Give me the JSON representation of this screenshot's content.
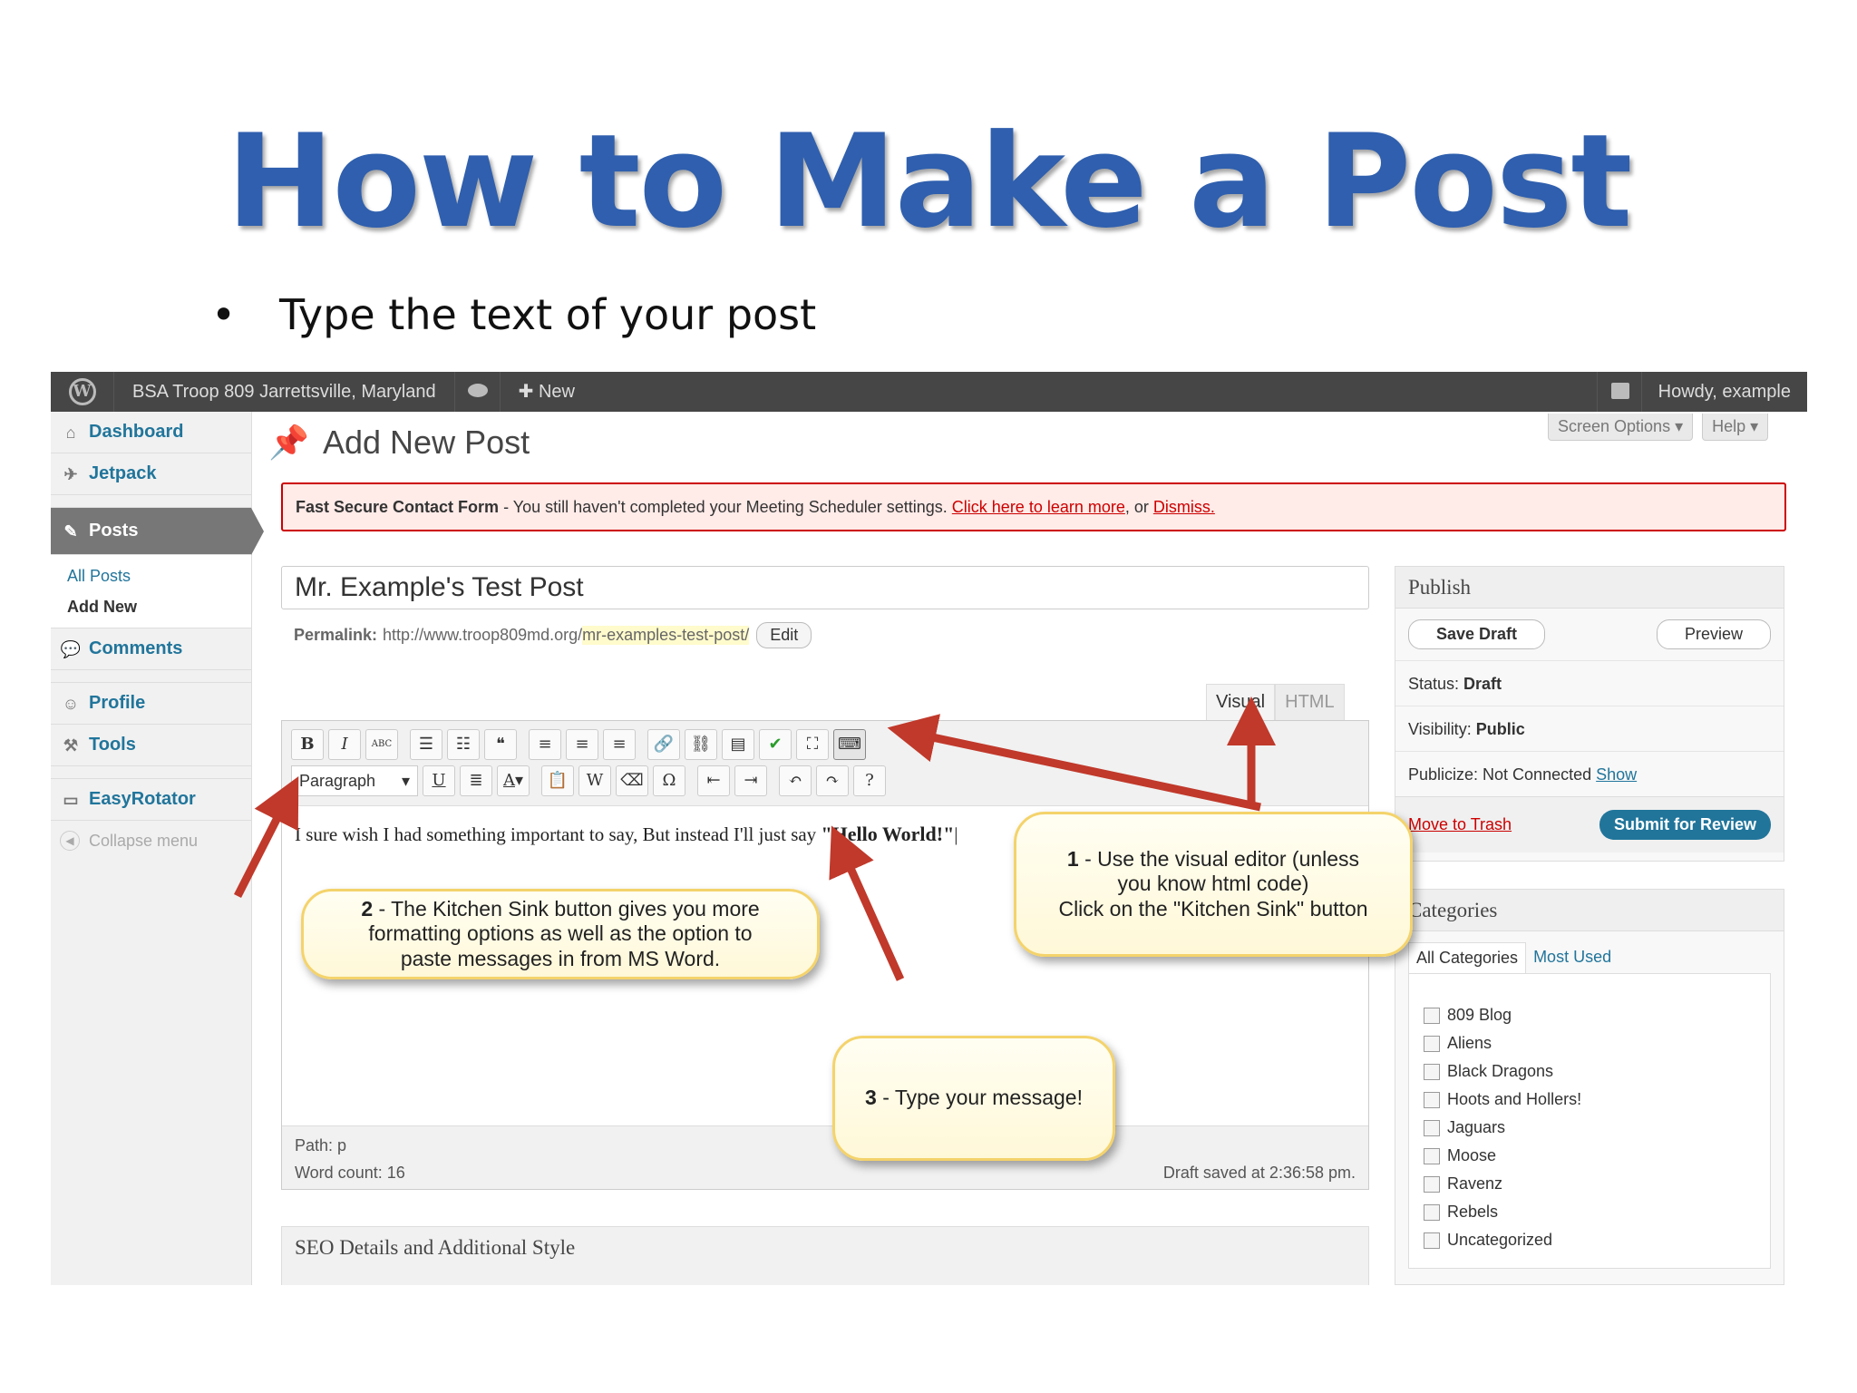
{
  "slide": {
    "title": "How to Make a Post",
    "bullet": "Type the text of your post"
  },
  "adminbar": {
    "site_name": "BSA Troop 809 Jarrettsville, Maryland",
    "new_label": "New",
    "howdy": "Howdy, example"
  },
  "sidebar": {
    "dashboard": "Dashboard",
    "jetpack": "Jetpack",
    "posts": "Posts",
    "all_posts": "All Posts",
    "add_new": "Add New",
    "comments": "Comments",
    "profile": "Profile",
    "tools": "Tools",
    "easyrotator": "EasyRotator",
    "collapse": "Collapse menu"
  },
  "header": {
    "page_title": "Add New Post",
    "screen_options": "Screen Options",
    "help": "Help"
  },
  "notice": {
    "plugin": "Fast Secure Contact Form",
    "message": " - You still haven't completed your Meeting Scheduler settings. ",
    "learn_link": "Click here to learn more",
    "or": ", or ",
    "dismiss": "Dismiss."
  },
  "post": {
    "title": "Mr. Example's Test Post",
    "permalink_label": "Permalink:",
    "permalink_base": "http://www.troop809md.org/",
    "permalink_slug": "mr-examples-test-post/",
    "edit": "Edit",
    "content_text": "I sure wish I had something important to say, But instead I'll just say ",
    "content_bold": "\"Hello World!\"",
    "path_label": "Path: ",
    "path_value": "p",
    "word_count": "Word count: 16",
    "draft_saved": "Draft saved at 2:36:58 pm."
  },
  "editor": {
    "tab_visual": "Visual",
    "tab_html": "HTML",
    "format_select": "Paragraph"
  },
  "seo": {
    "title": "SEO Details and Additional Style"
  },
  "publish": {
    "title": "Publish",
    "save_draft": "Save Draft",
    "preview": "Preview",
    "status_label": "Status: ",
    "status_value": "Draft",
    "visibility_label": "Visibility: ",
    "visibility_value": "Public",
    "publicize_label": "Publicize: Not Connected ",
    "publicize_link": "Show",
    "trash": "Move to Trash",
    "submit": "Submit for Review"
  },
  "categories": {
    "title": "Categories",
    "tab_all": "All Categories",
    "tab_used": "Most Used",
    "items": [
      "809 Blog",
      "Aliens",
      "Black Dragons",
      "Hoots and Hollers!",
      "Jaguars",
      "Moose",
      "Ravenz",
      "Rebels",
      "Uncategorized"
    ]
  },
  "callouts": {
    "c1_num": "1",
    "c1_line1": " - Use the visual editor (unless",
    "c1_line2": "you know html code)",
    "c1_line3": "Click on the \"Kitchen Sink\" button",
    "c2_num": "2",
    "c2_line1": " - The Kitchen Sink button gives you more",
    "c2_line2": "formatting options as well as the option to",
    "c2_line3": "paste messages in from MS Word.",
    "c3_num": "3",
    "c3_line1": " - Type your message!"
  },
  "colors": {
    "title_blue": "#2f5fae",
    "wp_link": "#21759b",
    "admin_bar": "#464646",
    "arrow_red": "#c0392b",
    "callout_border": "#f4d36b"
  }
}
